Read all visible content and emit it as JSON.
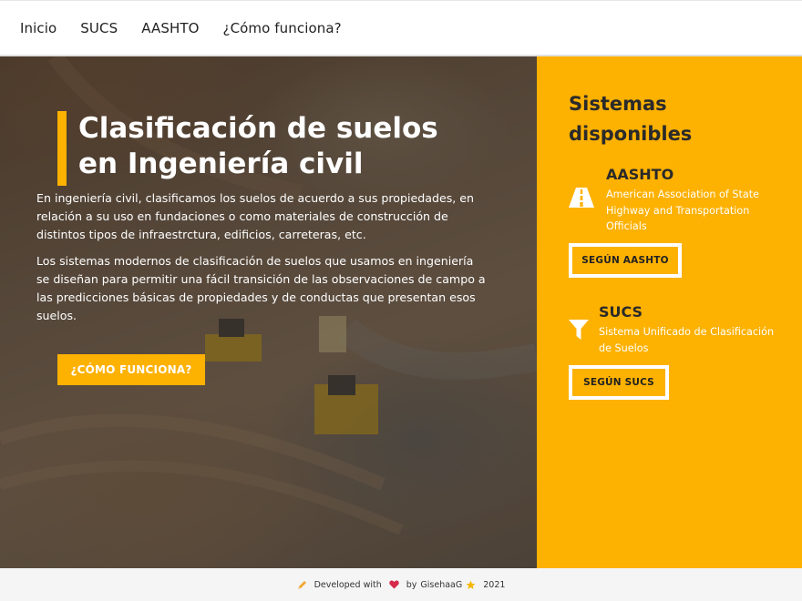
{
  "nav": {
    "items": [
      {
        "label": "Inicio"
      },
      {
        "label": "SUCS"
      },
      {
        "label": "AASHTO"
      },
      {
        "label": "¿Cómo funciona?"
      }
    ]
  },
  "hero": {
    "title_line1": "Clasificación de suelos",
    "title_line2": "en Ingeniería civil",
    "paragraph1": "En ingeniería civil, clasificamos los suelos de acuerdo a sus propiedades, en relación a su uso en fundaciones o como materiales de construcción de distintos tipos de infraestrctura, edificios, carreteras, etc.",
    "paragraph2": "Los sistemas modernos de clasificación de suelos que usamos en ingeniería se diseñan para permitir una fácil transición de las observaciones de campo a las predicciones básicas de propiedades y de conductas que presentan esos suelos.",
    "cta_label": "¿CÓMO FUNCIONA?",
    "background_icon": "construction-site-photo"
  },
  "sidebar": {
    "title_line1": "Sistemas",
    "title_line2": "disponibles",
    "systems": [
      {
        "name": "AASHTO",
        "description": "American Association of State Highway and Transportation Officials",
        "button_label": "SEGÚN AASHTO",
        "icon": "road-icon"
      },
      {
        "name": "SUCS",
        "description": "Sistema Unificado de Clasificación de Suelos",
        "button_label": "SEGÚN SUCS",
        "icon": "filter-icon"
      }
    ]
  },
  "footer": {
    "developed_with": "Developed with",
    "by": "by",
    "author": "GisehaaG",
    "year": "2021",
    "icons": [
      "pencil-icon",
      "heart-icon",
      "star-icon"
    ]
  },
  "colors": {
    "accent": "#fdb100",
    "text_dark": "#2a2a2a",
    "white": "#ffffff"
  }
}
